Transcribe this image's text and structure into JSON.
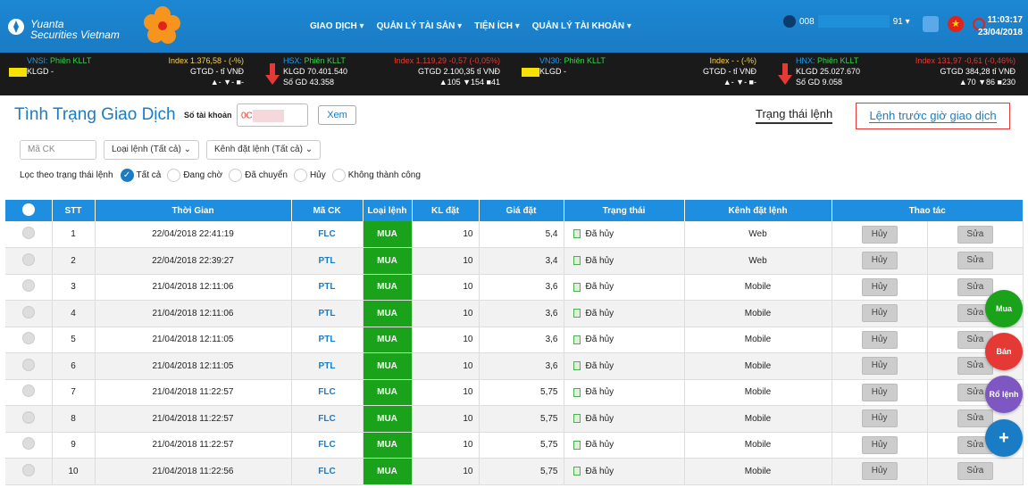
{
  "brand": {
    "line1": "Yuanta",
    "line2": "Securities Vietnam"
  },
  "nav": [
    "GIAO DỊCH ▾",
    "QUẢN LÝ TÀI SẢN ▾",
    "TIỆN ÍCH ▾",
    "QUẢN LÝ TÀI KHOẢN ▾"
  ],
  "user": {
    "prefix": "008",
    "suffix": "91 ▾"
  },
  "clock": {
    "time": "11:03:17",
    "date": "23/04/2018"
  },
  "ticker": [
    {
      "name": "VNSI:",
      "session": "Phiên KLLT",
      "index": "Index 1.376,58 - (-%)",
      "klgd": "KLGD -",
      "gtgd": "GTGD - tỉ VNĐ",
      "counts": "▲- ▼- ■-",
      "sogd": ""
    },
    {
      "name": "HSX:",
      "session": "Phiên KLLT",
      "index": "Index 1.119,29 -0,57 (-0,05%)",
      "klgd": "KLGD 70.401.540",
      "gtgd": "GTGD 2.100,35 tỉ VNĐ",
      "counts": "▲105 ▼154 ■41",
      "sogd": "Số GD 43.358"
    },
    {
      "name": "VN30:",
      "session": "Phiên KLLT",
      "index": "Index - - (-%)",
      "klgd": "KLGD -",
      "gtgd": "GTGD - tỉ VNĐ",
      "counts": "▲- ▼- ■-",
      "sogd": ""
    },
    {
      "name": "HNX:",
      "session": "Phiên KLLT",
      "index": "Index 131,97 -0,61 (-0,46%)",
      "klgd": "KLGD 25.027.670",
      "gtgd": "GTGD 384,28 tỉ VNĐ",
      "counts": "▲70 ▼86 ■230",
      "sogd": "Số GD 9.058"
    }
  ],
  "page": {
    "title": "Tình Trạng Giao Dịch",
    "account_label": "Số tài khoản",
    "account_value": "0C",
    "view_button": "Xem",
    "tab_status": "Trạng thái lệnh",
    "tab_preorder": "Lệnh trước giờ giao dịch"
  },
  "filters": {
    "code_placeholder": "Mã CK",
    "order_type": "Loại lệnh (Tất cả)",
    "channel": "Kênh đặt lệnh (Tất cả)",
    "status_label": "Lọc theo trạng thái lệnh",
    "statuses": [
      "Tất cả",
      "Đang chờ",
      "Đã chuyển",
      "Hủy",
      "Không thành công"
    ]
  },
  "table": {
    "headers": [
      "STT",
      "Thời Gian",
      "Mã CK",
      "Loại lệnh",
      "KL đặt",
      "Giá đặt",
      "Trạng thái",
      "Kênh đặt lệnh",
      "Thao tác"
    ],
    "cancel_label": "Hủy",
    "edit_label": "Sửa",
    "rows": [
      [
        "1",
        "22/04/2018 22:41:19",
        "FLC",
        "MUA",
        "10",
        "5,4",
        "Đã hủy",
        "Web"
      ],
      [
        "2",
        "22/04/2018 22:39:27",
        "PTL",
        "MUA",
        "10",
        "3,4",
        "Đã hủy",
        "Web"
      ],
      [
        "3",
        "21/04/2018 12:11:06",
        "PTL",
        "MUA",
        "10",
        "3,6",
        "Đã hủy",
        "Mobile"
      ],
      [
        "4",
        "21/04/2018 12:11:06",
        "PTL",
        "MUA",
        "10",
        "3,6",
        "Đã hủy",
        "Mobile"
      ],
      [
        "5",
        "21/04/2018 12:11:05",
        "PTL",
        "MUA",
        "10",
        "3,6",
        "Đã hủy",
        "Mobile"
      ],
      [
        "6",
        "21/04/2018 12:11:05",
        "PTL",
        "MUA",
        "10",
        "3,6",
        "Đã hủy",
        "Mobile"
      ],
      [
        "7",
        "21/04/2018 11:22:57",
        "FLC",
        "MUA",
        "10",
        "5,75",
        "Đã hủy",
        "Mobile"
      ],
      [
        "8",
        "21/04/2018 11:22:57",
        "FLC",
        "MUA",
        "10",
        "5,75",
        "Đã hủy",
        "Mobile"
      ],
      [
        "9",
        "21/04/2018 11:22:57",
        "FLC",
        "MUA",
        "10",
        "5,75",
        "Đã hủy",
        "Mobile"
      ],
      [
        "10",
        "21/04/2018 11:22:56",
        "FLC",
        "MUA",
        "10",
        "5,75",
        "Đã hủy",
        "Mobile"
      ]
    ]
  },
  "fab": {
    "buy": "Mua",
    "sell": "Bán",
    "basket": "Rổ lệnh",
    "add": "+"
  }
}
